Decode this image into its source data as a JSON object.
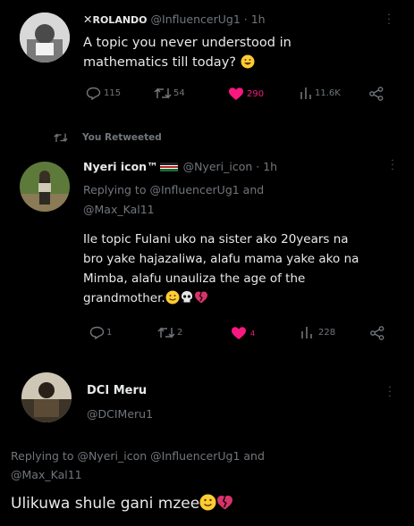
{
  "tweet1": {
    "name": "ROLANDO",
    "handle_time": "@InfluencerUg1 · 1h",
    "text_line1": "A topic you  never understood in",
    "text_line2": "mathematics till today?",
    "actions": {
      "replies": "115",
      "retweets": "54",
      "likes": "290",
      "views": "11.6K"
    }
  },
  "retweet_banner": "You Retweeted",
  "tweet2": {
    "name": "Nyeri icon™",
    "handle_time": "@Nyeri_icon · 1h",
    "replying_line1": "Replying to @InfluencerUg1 and",
    "replying_line2": "@Max_Kal11",
    "text_lines": [
      "Ile topic Fulani uko na sister ako 20years  na",
      "bro yake hajazaliwa, alafu mama yake ako na",
      "Mimba,  alafu unauliza the age  of the",
      "grandmother."
    ],
    "actions": {
      "replies": "1",
      "retweets": "2",
      "likes": "4",
      "views": "228"
    }
  },
  "tweet3": {
    "name": "DCI Meru",
    "handle": "@DCIMeru1",
    "replying_line1": "Replying to @Nyeri_icon @InfluencerUg1 and",
    "replying_line2": "@Max_Kal11",
    "text": "Ulikuwa shule gani mzee"
  },
  "colors": {
    "background": "#000000",
    "text": "#e7e9ea",
    "muted": "#71767b",
    "like": "#f91880"
  },
  "icons": [
    "reply-icon",
    "retweet-icon",
    "heart-icon",
    "views-icon",
    "share-icon",
    "more-dots-icon"
  ]
}
